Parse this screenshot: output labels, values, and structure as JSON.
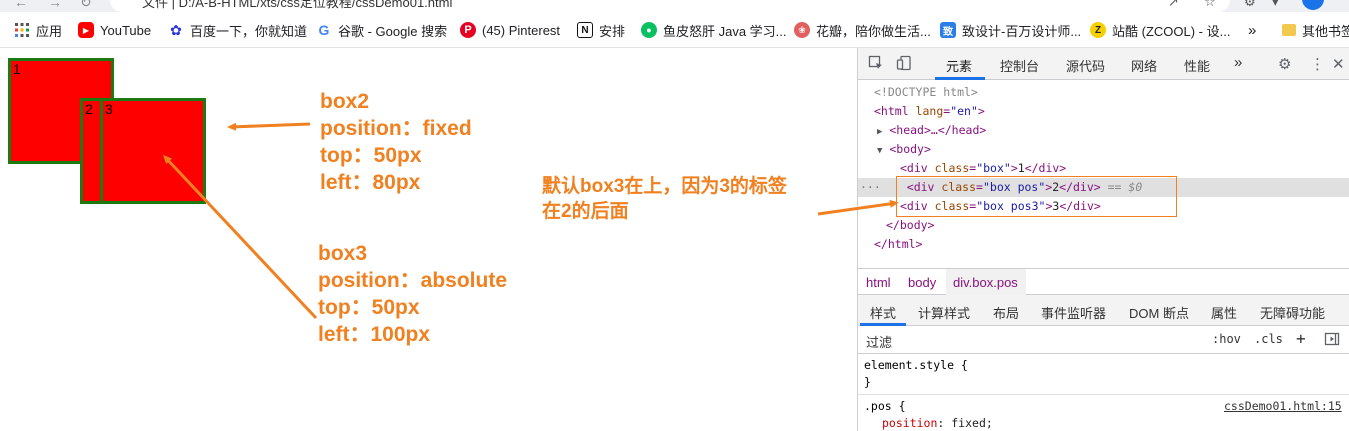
{
  "browser": {
    "url": "文件 | D:/A-B-HTML/xts/css定位教程/cssDemo01.html"
  },
  "bookmarks": {
    "items": [
      {
        "label": "应用",
        "icon": "apps-grid-icon",
        "color": "#4285f4"
      },
      {
        "label": "YouTube",
        "icon": "youtube-icon",
        "color": "#ff0000"
      },
      {
        "label": "百度一下，你就知道",
        "icon": "baidu-paw-icon",
        "color": "#2932e1"
      },
      {
        "label": "谷歌 - Google 搜索",
        "icon": "google-icon",
        "color": "#4285f4"
      },
      {
        "label": "(45) Pinterest",
        "icon": "pinterest-icon",
        "color": "#e60023"
      },
      {
        "label": "安排",
        "icon": "notion-icon",
        "color": "#111111"
      },
      {
        "label": "鱼皮怒肝 Java 学习...",
        "icon": "wechat-icon",
        "color": "#07c160"
      },
      {
        "label": "花瓣，陪你做生活...",
        "icon": "huaban-icon",
        "color": "#e25f5f"
      },
      {
        "label": "致设计-百万设计师...",
        "icon": "zhisheji-icon",
        "color": "#2b7de9"
      },
      {
        "label": "站酷 (ZCOOL) - 设...",
        "icon": "zcool-icon",
        "color": "#222222"
      },
      {
        "label": "»",
        "icon": "more-chevron-icon",
        "color": "#555555"
      },
      {
        "label": "其他书签",
        "icon": "folder-icon",
        "color": "#f2c94c"
      }
    ]
  },
  "page": {
    "boxes": [
      {
        "label": "1",
        "color": "#ff0000",
        "border": "#1c7a12"
      },
      {
        "label": "2",
        "color": "#ff0000",
        "border": "#1c7a12"
      },
      {
        "label": "3",
        "color": "#ff0000",
        "border": "#1c7a12"
      }
    ],
    "note_box2": [
      "box2",
      "position：fixed",
      "top：50px",
      "left：80px"
    ],
    "note_box3": [
      "box3",
      "position：absolute",
      "top：50px",
      "left：100px"
    ],
    "note_default": [
      "默认box3在上，因为3的标签",
      "在2的后面"
    ],
    "annotation_color": "#f08020"
  },
  "devtools": {
    "tabs": [
      "元素",
      "控制台",
      "源代码",
      "网络",
      "性能",
      "»"
    ],
    "active_tab": "元素",
    "code": {
      "doctype": "<!DOCTYPE html>",
      "html_open_tag": "<html ",
      "html_attr": "lang",
      "html_attr_val": "\"en\"",
      "html_close_bracket": ">",
      "head": "<head>…</head>",
      "body_open": "<body>",
      "div1_open": "<div ",
      "div1_attr": "class",
      "div1_val": "\"box\"",
      "div1_gt": ">",
      "div1_text": "1",
      "div1_close": "</div>",
      "div2_open": "<div ",
      "div2_attr": "class",
      "div2_val": "\"box pos\"",
      "div2_gt": ">",
      "div2_text": "2",
      "div2_close": "</div>",
      "div2_eq": " == ",
      "div2_dollar": "$0",
      "div3_open": "<div ",
      "div3_attr": "class",
      "div3_val": "\"box pos3\"",
      "div3_gt": ">",
      "div3_text": "3",
      "div3_close": "</div>",
      "body_close": "</body>",
      "html_close": "</html>",
      "ellipsis": "···"
    },
    "breadcrumbs": [
      "html",
      "body",
      "div.box.pos"
    ],
    "sub_tabs": [
      "样式",
      "计算样式",
      "布局",
      "事件监听器",
      "DOM 断点",
      "属性",
      "无障碍功能"
    ],
    "active_sub_tab": "样式",
    "filter_placeholder": "过滤",
    "hov": ":hov",
    "cls": ".cls",
    "plus": "+",
    "styles": {
      "element_style_open": "element.style {",
      "element_style_close": "}",
      "selector": ".pos {",
      "source_link": "cssDemo01.html:15",
      "prop": "position",
      "colon": ": ",
      "value": "fixed;"
    }
  }
}
